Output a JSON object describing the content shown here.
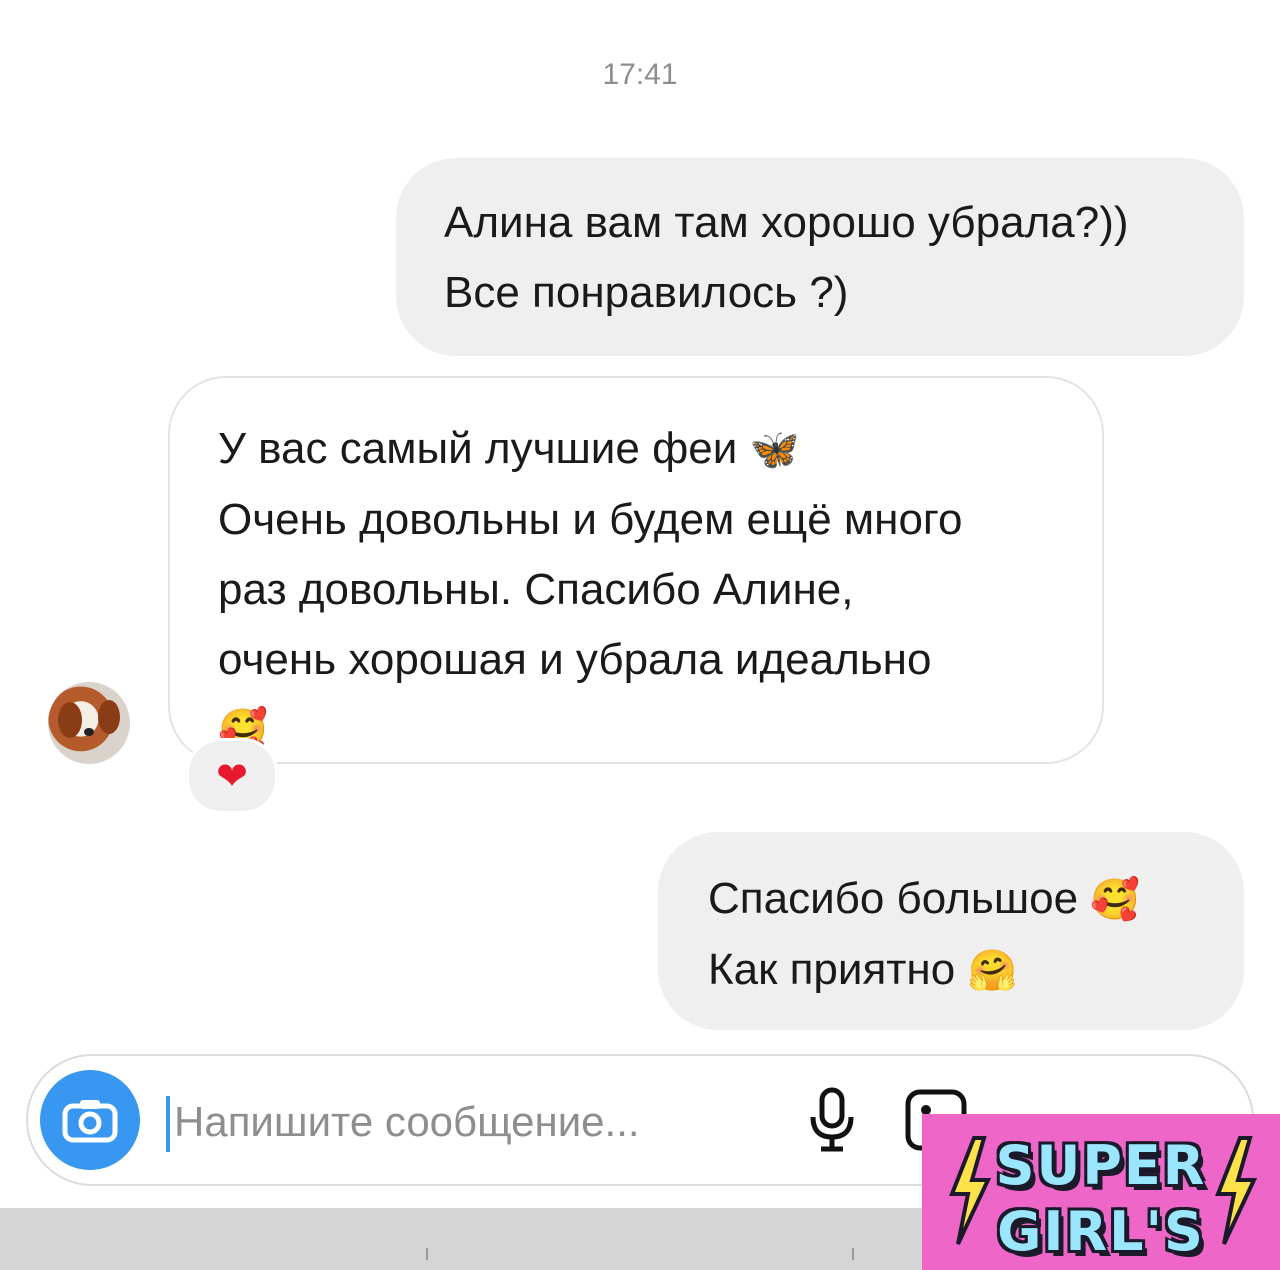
{
  "chat": {
    "timestamp": "17:41",
    "messages": [
      {
        "direction": "outgoing",
        "lines": [
          "Алина вам там хорошо убрала?))",
          "Все понравилось ?)"
        ]
      },
      {
        "direction": "incoming",
        "lines": [
          "У вас самый лучшие феи",
          "Очень довольны и будем ещё много",
          "раз довольны. Спасибо Алине,",
          "очень хорошая и убрала идеально"
        ],
        "emoji": "🥰",
        "line1_emoji": "🦋",
        "reaction": "❤"
      },
      {
        "direction": "outgoing",
        "lines": [
          "Спасибо большое",
          "Как приятно"
        ],
        "line1_emoji": "🥰",
        "line2_emoji": "🤗"
      }
    ]
  },
  "composer": {
    "placeholder": "Напишите сообщение...",
    "icons": [
      "camera-icon",
      "microphone-icon",
      "gallery-icon",
      "sticker-icon",
      "add-icon"
    ]
  },
  "sticker": {
    "line1": "SUPER",
    "line2": "GIRL'S",
    "background": "#ee66c7",
    "text_color": "#9be6ff",
    "bolt_color": "#ffe14a"
  },
  "colors": {
    "accent": "#3897f0",
    "outgoing_bubble": "#efefef",
    "timestamp": "#8e8e8e",
    "reaction": "#e8182e"
  }
}
